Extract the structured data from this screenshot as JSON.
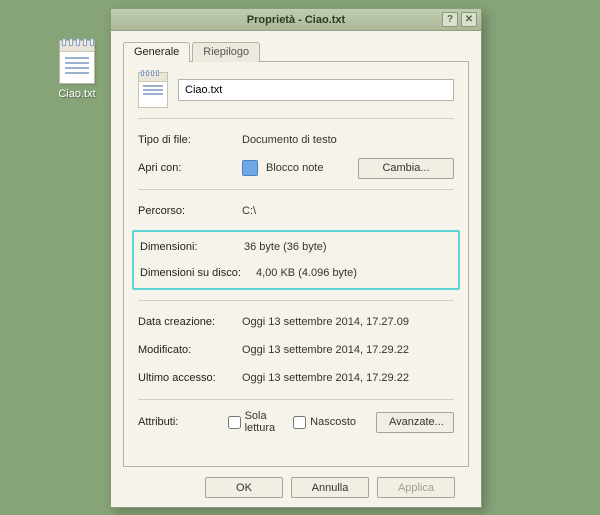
{
  "desktop": {
    "filename": "Ciao.txt"
  },
  "window": {
    "title": "Proprietà - Ciao.txt"
  },
  "tabs": {
    "general": "Generale",
    "summary": "Riepilogo"
  },
  "fields": {
    "filename": "Ciao.txt",
    "filetype_label": "Tipo di file:",
    "filetype_value": "Documento di testo",
    "openwith_label": "Apri con:",
    "openwith_value": "Blocco note",
    "change_button": "Cambia...",
    "path_label": "Percorso:",
    "path_value": "C:\\",
    "size_label": "Dimensioni:",
    "size_value": "36 byte (36 byte)",
    "diskSize_label": "Dimensioni su disco:",
    "diskSize_value": "4,00 KB (4.096 byte)",
    "created_label": "Data creazione:",
    "created_value": "Oggi 13 settembre 2014, 17.27.09",
    "modified_label": "Modificato:",
    "modified_value": "Oggi 13 settembre 2014, 17.29.22",
    "accessed_label": "Ultimo accesso:",
    "accessed_value": "Oggi 13 settembre 2014, 17.29.22",
    "attr_label": "Attributi:",
    "attr_readonly": "Sola lettura",
    "attr_hidden": "Nascosto",
    "advanced_button": "Avanzate..."
  },
  "buttons": {
    "ok": "OK",
    "cancel": "Annulla",
    "apply": "Applica"
  }
}
